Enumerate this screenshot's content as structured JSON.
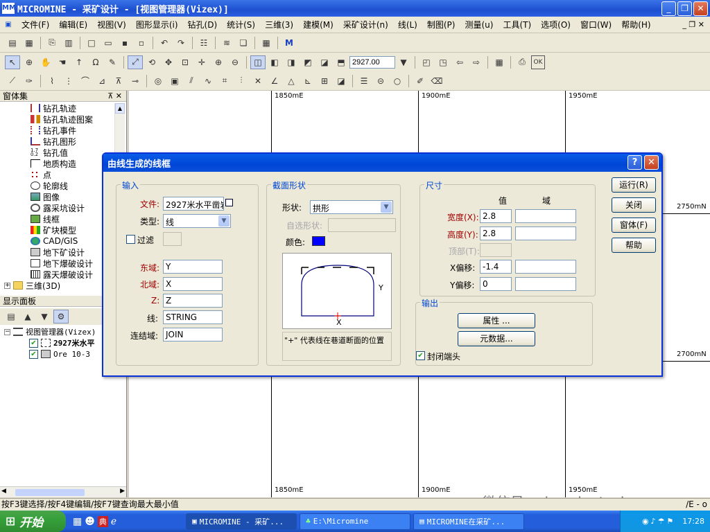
{
  "window": {
    "title": "MICROMINE - 采矿设计 - [视图管理器(Vizex)]",
    "logo_text": "MM"
  },
  "menubar": {
    "items": [
      "文件(F)",
      "编辑(E)",
      "视图(V)",
      "图形显示(i)",
      "钻孔(D)",
      "统计(S)",
      "三维(3)",
      "建模(M)",
      "采矿设计(n)",
      "线(L)",
      "制图(P)",
      "测量(u)",
      "工具(T)",
      "选项(O)",
      "窗口(W)",
      "帮助(H)"
    ]
  },
  "toolbar": {
    "elevation_value": "2927.00",
    "ok_label": "OK"
  },
  "left_panel": {
    "title": "窗体集",
    "tree_items": [
      "钻孔轨迹",
      "钻孔轨迹图案",
      "钻孔事件",
      "钻孔图形",
      "钻孔值",
      "地质构造",
      "点",
      "轮廓线",
      "图像",
      "露采坑设计",
      "线框",
      "矿块模型",
      "CAD/GIS",
      "地下矿设计",
      "地下爆破设计",
      "露天爆破设计"
    ],
    "group_3d": "三维(3D)",
    "display_title": "显示面板",
    "display_root": "视图管理器(Vizex)",
    "display_layers": [
      "2927米水平",
      "Ore 10-3"
    ]
  },
  "map": {
    "top_labels": [
      "1850mE",
      "1900mE",
      "1950mE"
    ],
    "bottom_labels": [
      "1850mE",
      "1900mE",
      "1950mE"
    ],
    "right_labels": [
      "2750mN",
      "2700mN"
    ]
  },
  "dialog": {
    "title": "由线生成的线框",
    "help_icon": "?",
    "input_group": "输入",
    "file_label": "文件:",
    "file_value": "2927米水平凿岩",
    "type_label": "类型:",
    "type_value": "线",
    "filter_label": "过滤",
    "east_label": "东域:",
    "east_value": "Y",
    "north_label": "北域:",
    "north_value": "X",
    "z_label": "Z:",
    "z_value": "Z",
    "line_label": "线:",
    "line_value": "STRING",
    "join_label": "连结域:",
    "join_value": "JOIN",
    "section_group": "截面形状",
    "shape_label": "形状:",
    "shape_value": "拱形",
    "custom_shape_label": "自选形状:",
    "color_label": "颜色:",
    "color_value": "#0000ff",
    "preview_x": "X",
    "preview_y": "Y",
    "note": "\"+\" 代表线在巷道断面的位置",
    "size_group": "尺寸",
    "col_value": "值",
    "col_field": "域",
    "width_label": "宽度(X):",
    "width_value": "2.8",
    "height_label": "高度(Y):",
    "height_value": "2.8",
    "top_label": "顶部(T):",
    "xoffset_label": "X偏移:",
    "xoffset_value": "-1.4",
    "yoffset_label": "Y偏移:",
    "yoffset_value": "0",
    "output_group": "输出",
    "properties_btn": "属性 ...",
    "metadata_btn": "元数据...",
    "close_ends_label": "封闭端头",
    "run_btn": "运行(R)",
    "close_btn": "关闭",
    "form_btn": "窗体(F)",
    "help_btn": "帮助"
  },
  "statusbar": {
    "text": "按F3键选择/按F4键编辑/按F7键查询最大最小值",
    "right_text": "/E - o"
  },
  "taskbar": {
    "start_label": "开始",
    "tasks": [
      "MICROMINE - 采矿...",
      "E:\\Micromine",
      "MICROMINE在采矿..."
    ],
    "clock": "17:28"
  },
  "watermark": "微信号: wiseminetech"
}
